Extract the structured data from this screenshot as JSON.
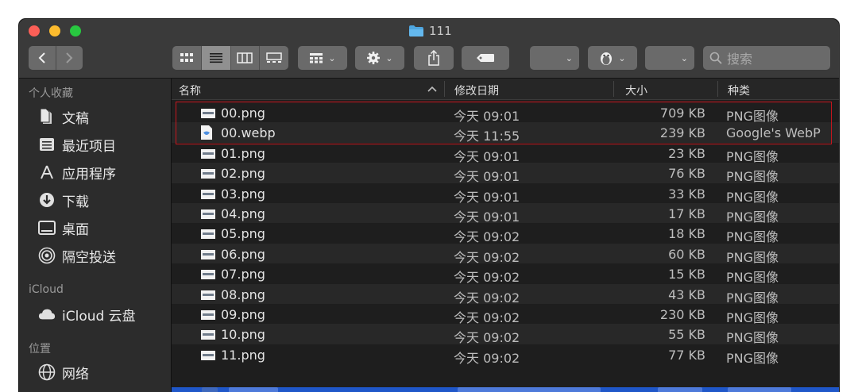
{
  "window": {
    "title": "111"
  },
  "toolbar": {
    "search_placeholder": "搜索"
  },
  "sidebar": {
    "favorites_header": "个人收藏",
    "favorites": [
      {
        "label": "文稿",
        "icon": "document-icon"
      },
      {
        "label": "最近项目",
        "icon": "recents-icon"
      },
      {
        "label": "应用程序",
        "icon": "applications-icon"
      },
      {
        "label": "下载",
        "icon": "download-icon"
      },
      {
        "label": "桌面",
        "icon": "desktop-icon"
      },
      {
        "label": "隔空投送",
        "icon": "airdrop-icon"
      }
    ],
    "icloud_header": "iCloud",
    "icloud": [
      {
        "label": "iCloud 云盘",
        "icon": "cloud-icon"
      }
    ],
    "locations_header": "位置",
    "locations": [
      {
        "label": "网络",
        "icon": "network-icon"
      }
    ]
  },
  "columns": {
    "name": "名称",
    "date": "修改日期",
    "size": "大小",
    "kind": "种类"
  },
  "files": [
    {
      "name": "00.png",
      "date": "今天 09:01",
      "size": "709 KB",
      "kind": "PNG图像"
    },
    {
      "name": "00.webp",
      "date": "今天 11:55",
      "size": "239 KB",
      "kind": "Google's WebP"
    },
    {
      "name": "01.png",
      "date": "今天 09:01",
      "size": "23 KB",
      "kind": "PNG图像"
    },
    {
      "name": "02.png",
      "date": "今天 09:01",
      "size": "76 KB",
      "kind": "PNG图像"
    },
    {
      "name": "03.png",
      "date": "今天 09:01",
      "size": "33 KB",
      "kind": "PNG图像"
    },
    {
      "name": "04.png",
      "date": "今天 09:01",
      "size": "17 KB",
      "kind": "PNG图像"
    },
    {
      "name": "05.png",
      "date": "今天 09:02",
      "size": "18 KB",
      "kind": "PNG图像"
    },
    {
      "name": "06.png",
      "date": "今天 09:02",
      "size": "60 KB",
      "kind": "PNG图像"
    },
    {
      "name": "07.png",
      "date": "今天 09:02",
      "size": "15 KB",
      "kind": "PNG图像"
    },
    {
      "name": "08.png",
      "date": "今天 09:02",
      "size": "43 KB",
      "kind": "PNG图像"
    },
    {
      "name": "09.png",
      "date": "今天 09:02",
      "size": "230 KB",
      "kind": "PNG图像"
    },
    {
      "name": "10.png",
      "date": "今天 09:02",
      "size": "55 KB",
      "kind": "PNG图像"
    },
    {
      "name": "11.png",
      "date": "今天 09:02",
      "size": "77 KB",
      "kind": "PNG图像"
    }
  ]
}
